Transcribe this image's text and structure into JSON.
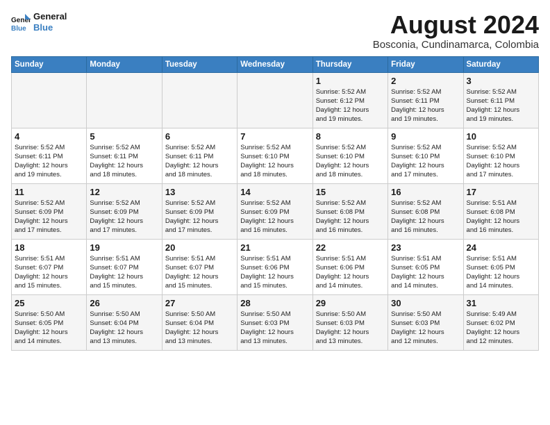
{
  "header": {
    "logo_line1": "General",
    "logo_line2": "Blue",
    "month_year": "August 2024",
    "location": "Bosconia, Cundinamarca, Colombia"
  },
  "days_of_week": [
    "Sunday",
    "Monday",
    "Tuesday",
    "Wednesday",
    "Thursday",
    "Friday",
    "Saturday"
  ],
  "weeks": [
    [
      {
        "day": "",
        "info": ""
      },
      {
        "day": "",
        "info": ""
      },
      {
        "day": "",
        "info": ""
      },
      {
        "day": "",
        "info": ""
      },
      {
        "day": "1",
        "info": "Sunrise: 5:52 AM\nSunset: 6:12 PM\nDaylight: 12 hours\nand 19 minutes."
      },
      {
        "day": "2",
        "info": "Sunrise: 5:52 AM\nSunset: 6:11 PM\nDaylight: 12 hours\nand 19 minutes."
      },
      {
        "day": "3",
        "info": "Sunrise: 5:52 AM\nSunset: 6:11 PM\nDaylight: 12 hours\nand 19 minutes."
      }
    ],
    [
      {
        "day": "4",
        "info": "Sunrise: 5:52 AM\nSunset: 6:11 PM\nDaylight: 12 hours\nand 19 minutes."
      },
      {
        "day": "5",
        "info": "Sunrise: 5:52 AM\nSunset: 6:11 PM\nDaylight: 12 hours\nand 18 minutes."
      },
      {
        "day": "6",
        "info": "Sunrise: 5:52 AM\nSunset: 6:11 PM\nDaylight: 12 hours\nand 18 minutes."
      },
      {
        "day": "7",
        "info": "Sunrise: 5:52 AM\nSunset: 6:10 PM\nDaylight: 12 hours\nand 18 minutes."
      },
      {
        "day": "8",
        "info": "Sunrise: 5:52 AM\nSunset: 6:10 PM\nDaylight: 12 hours\nand 18 minutes."
      },
      {
        "day": "9",
        "info": "Sunrise: 5:52 AM\nSunset: 6:10 PM\nDaylight: 12 hours\nand 17 minutes."
      },
      {
        "day": "10",
        "info": "Sunrise: 5:52 AM\nSunset: 6:10 PM\nDaylight: 12 hours\nand 17 minutes."
      }
    ],
    [
      {
        "day": "11",
        "info": "Sunrise: 5:52 AM\nSunset: 6:09 PM\nDaylight: 12 hours\nand 17 minutes."
      },
      {
        "day": "12",
        "info": "Sunrise: 5:52 AM\nSunset: 6:09 PM\nDaylight: 12 hours\nand 17 minutes."
      },
      {
        "day": "13",
        "info": "Sunrise: 5:52 AM\nSunset: 6:09 PM\nDaylight: 12 hours\nand 17 minutes."
      },
      {
        "day": "14",
        "info": "Sunrise: 5:52 AM\nSunset: 6:09 PM\nDaylight: 12 hours\nand 16 minutes."
      },
      {
        "day": "15",
        "info": "Sunrise: 5:52 AM\nSunset: 6:08 PM\nDaylight: 12 hours\nand 16 minutes."
      },
      {
        "day": "16",
        "info": "Sunrise: 5:52 AM\nSunset: 6:08 PM\nDaylight: 12 hours\nand 16 minutes."
      },
      {
        "day": "17",
        "info": "Sunrise: 5:51 AM\nSunset: 6:08 PM\nDaylight: 12 hours\nand 16 minutes."
      }
    ],
    [
      {
        "day": "18",
        "info": "Sunrise: 5:51 AM\nSunset: 6:07 PM\nDaylight: 12 hours\nand 15 minutes."
      },
      {
        "day": "19",
        "info": "Sunrise: 5:51 AM\nSunset: 6:07 PM\nDaylight: 12 hours\nand 15 minutes."
      },
      {
        "day": "20",
        "info": "Sunrise: 5:51 AM\nSunset: 6:07 PM\nDaylight: 12 hours\nand 15 minutes."
      },
      {
        "day": "21",
        "info": "Sunrise: 5:51 AM\nSunset: 6:06 PM\nDaylight: 12 hours\nand 15 minutes."
      },
      {
        "day": "22",
        "info": "Sunrise: 5:51 AM\nSunset: 6:06 PM\nDaylight: 12 hours\nand 14 minutes."
      },
      {
        "day": "23",
        "info": "Sunrise: 5:51 AM\nSunset: 6:05 PM\nDaylight: 12 hours\nand 14 minutes."
      },
      {
        "day": "24",
        "info": "Sunrise: 5:51 AM\nSunset: 6:05 PM\nDaylight: 12 hours\nand 14 minutes."
      }
    ],
    [
      {
        "day": "25",
        "info": "Sunrise: 5:50 AM\nSunset: 6:05 PM\nDaylight: 12 hours\nand 14 minutes."
      },
      {
        "day": "26",
        "info": "Sunrise: 5:50 AM\nSunset: 6:04 PM\nDaylight: 12 hours\nand 13 minutes."
      },
      {
        "day": "27",
        "info": "Sunrise: 5:50 AM\nSunset: 6:04 PM\nDaylight: 12 hours\nand 13 minutes."
      },
      {
        "day": "28",
        "info": "Sunrise: 5:50 AM\nSunset: 6:03 PM\nDaylight: 12 hours\nand 13 minutes."
      },
      {
        "day": "29",
        "info": "Sunrise: 5:50 AM\nSunset: 6:03 PM\nDaylight: 12 hours\nand 13 minutes."
      },
      {
        "day": "30",
        "info": "Sunrise: 5:50 AM\nSunset: 6:03 PM\nDaylight: 12 hours\nand 12 minutes."
      },
      {
        "day": "31",
        "info": "Sunrise: 5:49 AM\nSunset: 6:02 PM\nDaylight: 12 hours\nand 12 minutes."
      }
    ]
  ]
}
